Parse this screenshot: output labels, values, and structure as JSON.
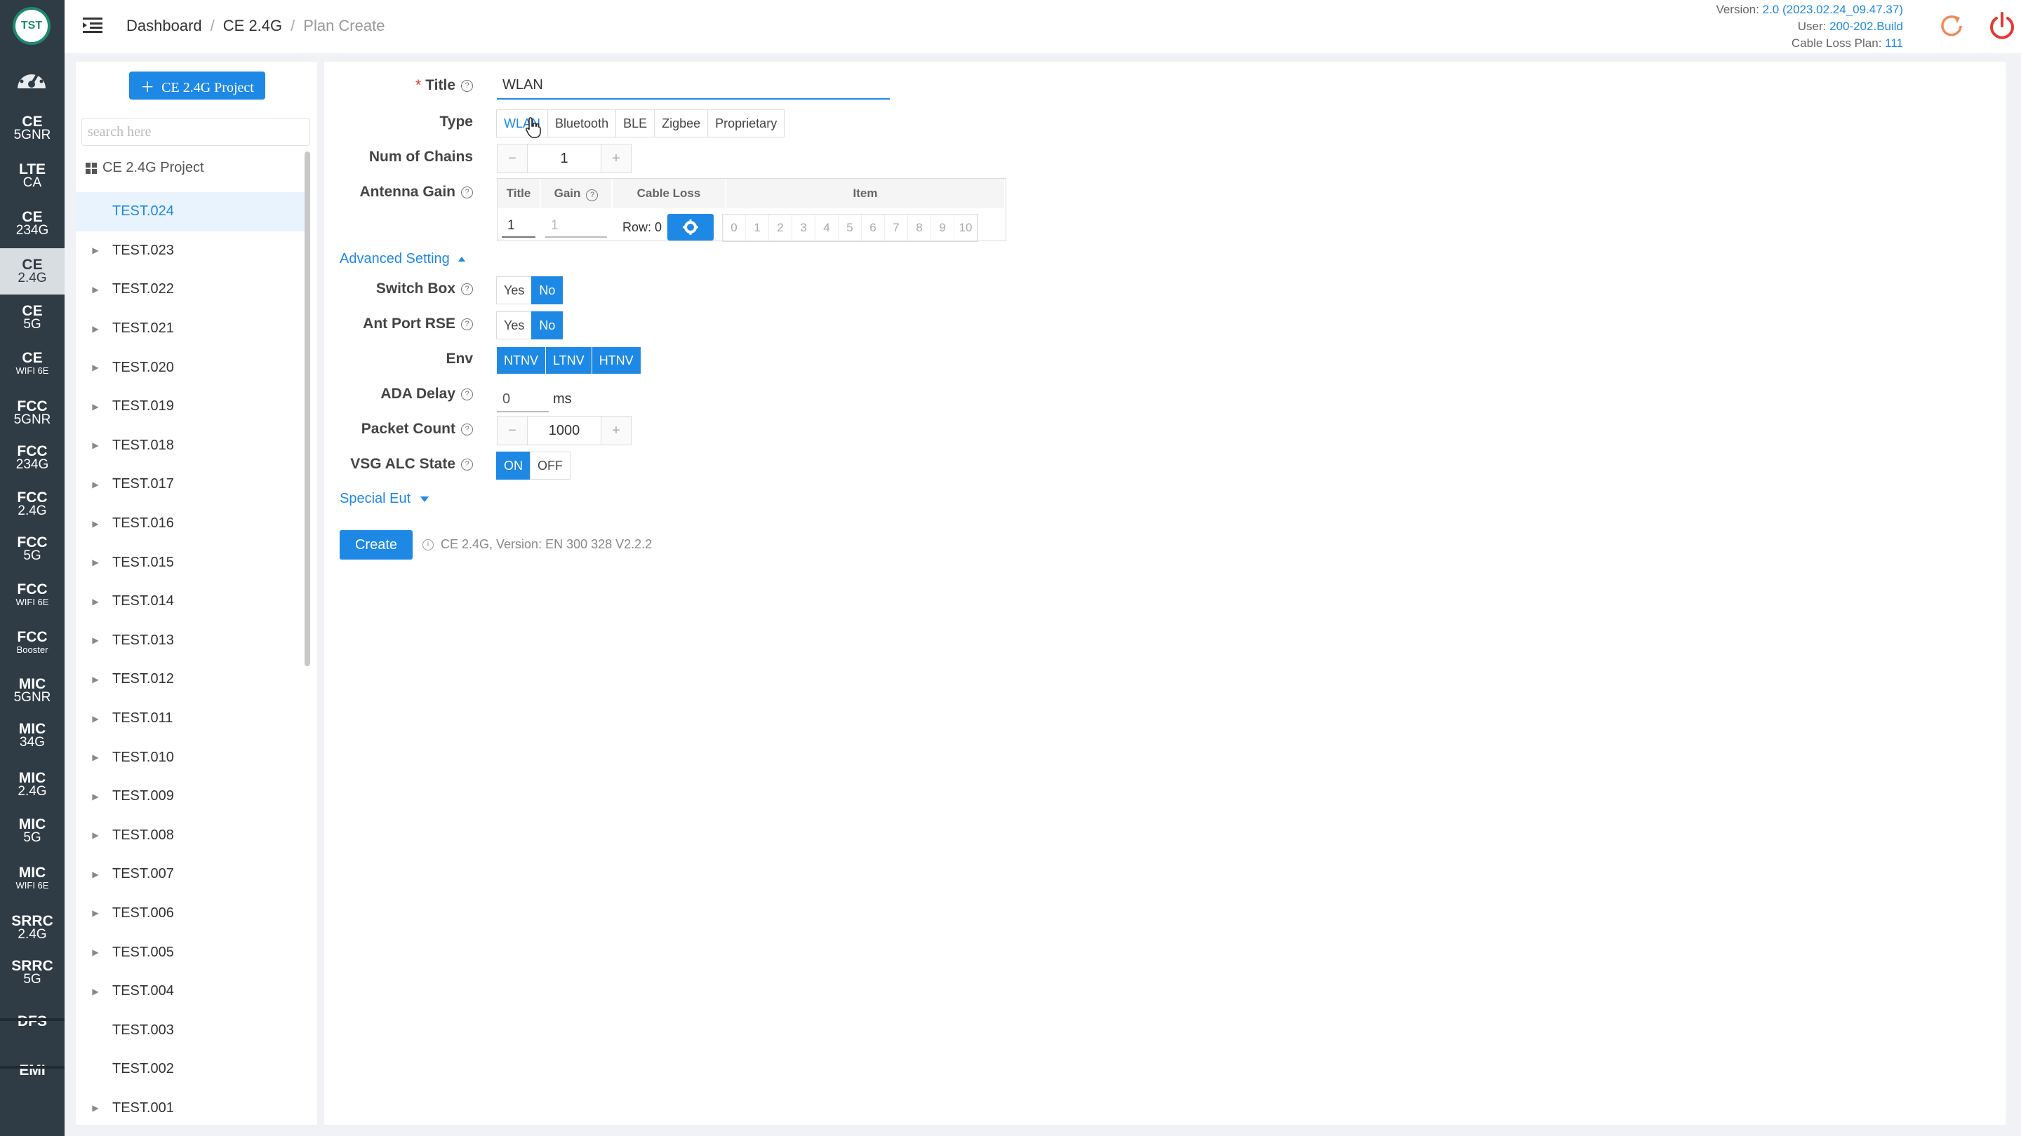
{
  "nav": {
    "logo": "TST",
    "items": [
      {
        "t": "CE",
        "b": "5GNR",
        "small": false
      },
      {
        "t": "LTE",
        "b": "CA",
        "small": false
      },
      {
        "t": "CE",
        "b": "234G",
        "small": false
      },
      {
        "t": "CE",
        "b": "2.4G",
        "small": false,
        "active": true
      },
      {
        "t": "CE",
        "b": "5G",
        "small": false
      },
      {
        "t": "CE",
        "b": "WIFI 6E",
        "small": true
      },
      {
        "t": "FCC",
        "b": "5GNR",
        "small": false
      },
      {
        "t": "FCC",
        "b": "234G",
        "small": false
      },
      {
        "t": "FCC",
        "b": "2.4G",
        "small": false
      },
      {
        "t": "FCC",
        "b": "5G",
        "small": false
      },
      {
        "t": "FCC",
        "b": "WIFI 6E",
        "small": true
      },
      {
        "t": "FCC",
        "b": "Booster",
        "small": true
      },
      {
        "t": "MIC",
        "b": "5GNR",
        "small": false
      },
      {
        "t": "MIC",
        "b": "34G",
        "small": false
      },
      {
        "t": "MIC",
        "b": "2.4G",
        "small": false
      },
      {
        "t": "MIC",
        "b": "5G",
        "small": false
      },
      {
        "t": "MIC",
        "b": "WIFI 6E",
        "small": true
      },
      {
        "t": "SRRC",
        "b": "2.4G",
        "small": false
      },
      {
        "t": "SRRC",
        "b": "5G",
        "small": false
      },
      {
        "t": "DFS",
        "b": "",
        "small": false
      },
      {
        "t": "EMI",
        "b": "",
        "small": false
      }
    ]
  },
  "header": {
    "breadcrumb": [
      "Dashboard",
      "CE 2.4G",
      "Plan Create"
    ],
    "version_label": "Version:",
    "version_value": "2.0 (2023.02.24_09.47.37)",
    "user_label": "User:",
    "user_value": "200-202.Build",
    "cable_label": "Cable Loss Plan:",
    "cable_value": "111"
  },
  "tree": {
    "add_label": "CE 2.4G Project",
    "search_placeholder": "search here",
    "root": "CE 2.4G Project",
    "nodes": [
      {
        "label": "TEST.024",
        "arrow": false,
        "sel": true
      },
      {
        "label": "TEST.023",
        "arrow": true
      },
      {
        "label": "TEST.022",
        "arrow": true
      },
      {
        "label": "TEST.021",
        "arrow": true
      },
      {
        "label": "TEST.020",
        "arrow": true
      },
      {
        "label": "TEST.019",
        "arrow": true
      },
      {
        "label": "TEST.018",
        "arrow": true
      },
      {
        "label": "TEST.017",
        "arrow": true
      },
      {
        "label": "TEST.016",
        "arrow": true
      },
      {
        "label": "TEST.015",
        "arrow": true
      },
      {
        "label": "TEST.014",
        "arrow": true
      },
      {
        "label": "TEST.013",
        "arrow": true
      },
      {
        "label": "TEST.012",
        "arrow": true
      },
      {
        "label": "TEST.011",
        "arrow": true
      },
      {
        "label": "TEST.010",
        "arrow": true
      },
      {
        "label": "TEST.009",
        "arrow": true
      },
      {
        "label": "TEST.008",
        "arrow": true
      },
      {
        "label": "TEST.007",
        "arrow": true
      },
      {
        "label": "TEST.006",
        "arrow": true
      },
      {
        "label": "TEST.005",
        "arrow": true
      },
      {
        "label": "TEST.004",
        "arrow": true
      },
      {
        "label": "TEST.003",
        "arrow": false
      },
      {
        "label": "TEST.002",
        "arrow": false
      },
      {
        "label": "TEST.001",
        "arrow": true
      }
    ]
  },
  "form": {
    "title_label": "Title",
    "title_value": "WLAN",
    "type_label": "Type",
    "type_options": [
      "WLAN",
      "Bluetooth",
      "BLE",
      "Zigbee",
      "Proprietary"
    ],
    "type_selected": "WLAN",
    "chains_label": "Num of Chains",
    "chains_value": "1",
    "gain_label": "Antenna Gain",
    "gain_cols": {
      "title": "Title",
      "gain": "Gain",
      "cable": "Cable Loss",
      "item": "Item"
    },
    "gain_row": {
      "title": "1",
      "gain": "1",
      "row": "Row: 0"
    },
    "items": [
      "0",
      "1",
      "2",
      "3",
      "4",
      "5",
      "6",
      "7",
      "8",
      "9",
      "10"
    ],
    "advanced_label": "Advanced Setting",
    "switch_label": "Switch Box",
    "switch_yes": "Yes",
    "switch_no": "No",
    "antport_label": "Ant Port RSE",
    "antport_yes": "Yes",
    "antport_no": "No",
    "env_label": "Env",
    "env_options": [
      "NTNV",
      "LTNV",
      "HTNV"
    ],
    "ada_label": "ADA Delay",
    "ada_value": "0",
    "ada_unit": "ms",
    "packet_label": "Packet Count",
    "packet_value": "1000",
    "vsg_label": "VSG ALC State",
    "vsg_on": "ON",
    "vsg_off": "OFF",
    "special_label": "Special Eut",
    "create_label": "Create",
    "info_text": "CE 2.4G, Version: EN 300 328 V2.2.2"
  },
  "colors": {
    "accent": "#1e88e5",
    "nav_bg": "#2f3b45",
    "danger": "#e53935"
  }
}
